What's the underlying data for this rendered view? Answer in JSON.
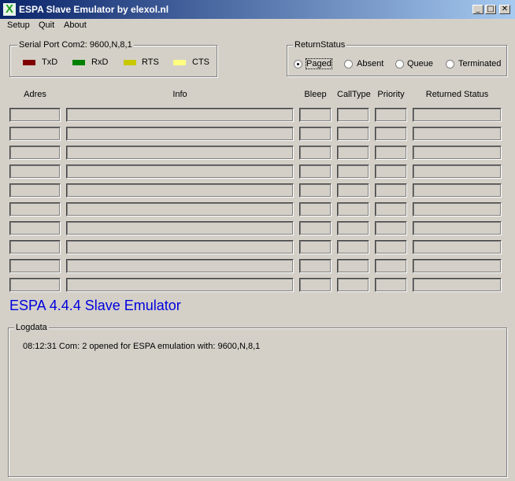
{
  "window": {
    "title": "ESPA Slave Emulator by elexol.nl",
    "icon_glyph": "X",
    "buttons": {
      "minimize": "_",
      "maximize": "□",
      "close": "✕"
    }
  },
  "menu": [
    "Setup",
    "Quit",
    "About"
  ],
  "serial_port": {
    "caption": "Serial Port Com2:  9600,N,8,1",
    "leds": [
      {
        "label": "TxD",
        "color": "#800000"
      },
      {
        "label": "RxD",
        "color": "#008000"
      },
      {
        "label": "RTS",
        "color": "#c8c800"
      },
      {
        "label": "CTS",
        "color": "#ffff80"
      }
    ]
  },
  "return_status": {
    "caption": "ReturnStatus",
    "options": [
      {
        "label": "Paged",
        "checked": true
      },
      {
        "label": "Absent",
        "checked": false
      },
      {
        "label": "Queue",
        "checked": false
      },
      {
        "label": "Terminated",
        "checked": false
      }
    ]
  },
  "table": {
    "columns": [
      "Adres",
      "Info",
      "Bleep",
      "CallType",
      "Priority",
      "Returned Status"
    ],
    "rows": [
      [
        "",
        "",
        "",
        "",
        "",
        ""
      ],
      [
        "",
        "",
        "",
        "",
        "",
        ""
      ],
      [
        "",
        "",
        "",
        "",
        "",
        ""
      ],
      [
        "",
        "",
        "",
        "",
        "",
        ""
      ],
      [
        "",
        "",
        "",
        "",
        "",
        ""
      ],
      [
        "",
        "",
        "",
        "",
        "",
        ""
      ],
      [
        "",
        "",
        "",
        "",
        "",
        ""
      ],
      [
        "",
        "",
        "",
        "",
        "",
        ""
      ],
      [
        "",
        "",
        "",
        "",
        "",
        ""
      ],
      [
        "",
        "",
        "",
        "",
        "",
        ""
      ]
    ]
  },
  "emulator_title": "ESPA 4.4.4 Slave Emulator",
  "log": {
    "caption": "Logdata",
    "lines": [
      "08:12:31 Com: 2 opened for ESPA emulation with: 9600,N,8,1"
    ]
  }
}
